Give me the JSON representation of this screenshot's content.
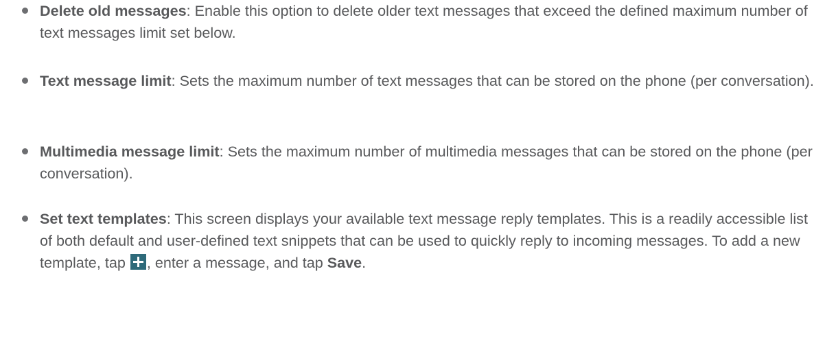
{
  "items": [
    {
      "term": "Delete old messages",
      "description": ": Enable this option to delete older text messages that exceed the defined maximum number of text messages limit set below."
    },
    {
      "term": "Text message limit",
      "description": ": Sets the maximum number of text messages that can be stored on the phone (per conversation)."
    },
    {
      "term": "Multimedia message limit",
      "description": ": Sets the maximum number of multimedia messages that can be stored on the phone (per conversation)."
    },
    {
      "term": "Set text templates",
      "description_before_icon": ": This screen displays your available text message reply templates. This is a readily accessible list of both default and user-defined text snippets that can be used to quickly reply to incoming messages. To add a new template, tap ",
      "description_after_icon": ", enter a message, and tap ",
      "save_label": "Save",
      "end": ".",
      "icon": "add-icon"
    }
  ],
  "colors": {
    "text": "#58595b",
    "bullet": "#6d6e71",
    "icon_background": "#2e6a7a"
  }
}
